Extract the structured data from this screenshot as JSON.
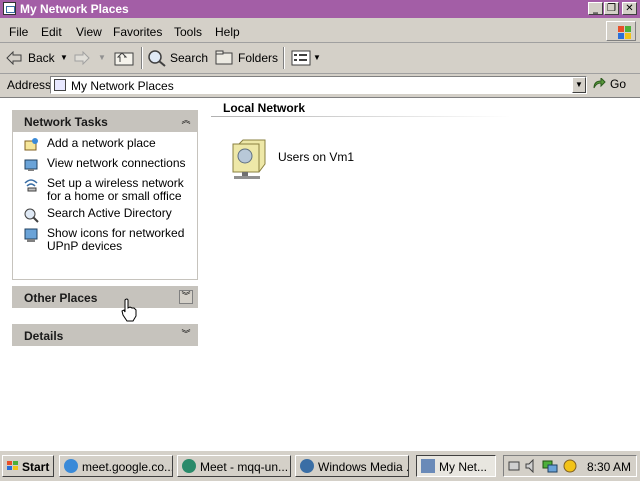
{
  "window": {
    "title": "My Network Places",
    "title_bar_color": "#a35ea6"
  },
  "caption_buttons": {
    "minimize": "_",
    "restore": "❐",
    "close": "✕"
  },
  "menubar": {
    "items": [
      "File",
      "Edit",
      "View",
      "Favorites",
      "Tools",
      "Help"
    ]
  },
  "toolbar": {
    "back_label": "Back",
    "search_label": "Search",
    "folders_label": "Folders"
  },
  "address": {
    "label": "Address",
    "value": "My Network Places",
    "go_label": "Go"
  },
  "tasks_panel": {
    "network_tasks_title": "Network Tasks",
    "items": [
      {
        "label": "Add a network place",
        "icon": "add-network-place-icon"
      },
      {
        "label": "View network connections",
        "icon": "network-connections-icon"
      },
      {
        "label": "Set up a wireless network for a home or small office",
        "icon": "wireless-network-icon"
      },
      {
        "label": "Search Active Directory",
        "icon": "search-directory-icon"
      },
      {
        "label": "Show icons for networked UPnP devices",
        "icon": "upnp-devices-icon"
      }
    ],
    "other_places_title": "Other Places",
    "details_title": "Details"
  },
  "main": {
    "group_header": "Local Network",
    "items": [
      {
        "label": "Users on Vm1",
        "icon": "network-share-folder-icon"
      }
    ]
  },
  "taskbar": {
    "start_label": "Start",
    "buttons": [
      {
        "label": "meet.google.co..."
      },
      {
        "label": "Meet - mqq-un..."
      },
      {
        "label": "Windows Media ..."
      },
      {
        "label": "My Net..."
      }
    ],
    "clock": "8:30 AM"
  }
}
